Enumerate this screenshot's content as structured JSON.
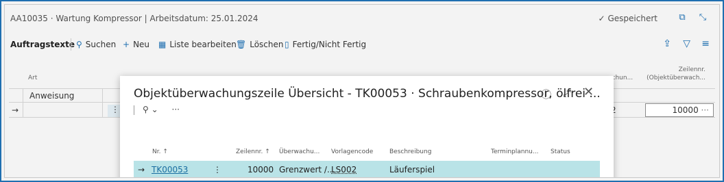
{
  "window": {
    "title": "AA10035 · Wartung Kompressor | Arbeitsdatum: 25.01.2024",
    "saved_label": "Gespeichert"
  },
  "toolbar": {
    "section_label": "Auftragstexte",
    "search_label": "Suchen",
    "new_label": "Neu",
    "edit_list_label": "Liste bearbeiten",
    "delete_label": "Löschen",
    "done_label": "Fertig/Nicht Fertig"
  },
  "grid": {
    "col_art": "Art",
    "col_right1": "achun...",
    "col_right2_line1": "Zeilennr.",
    "col_right2_line2": "(Objektüberwach...",
    "row1_art": "Anweisung",
    "row2_arrow": "→",
    "row2_menu": "⋮",
    "row2_right1": "2",
    "row2_value": "10000"
  },
  "dialog": {
    "title": "Objektüberwachungszeile Übersicht - TK00053 · Schraubenkompressor, ölfrei ...",
    "more": "···",
    "columns": [
      "Nr. ↑",
      "Zeilennr. ↑",
      "Überwachu...",
      "Vorlagencode",
      "Beschreibung",
      "Terminplannu...",
      "Status"
    ],
    "row": {
      "arrow": "→",
      "nr": "TK00053",
      "menu": "⋮",
      "zeilennr": "10000",
      "ueberwachung": "Grenzwert /...",
      "vorlagencode": "LS002",
      "beschreibung": "Läuferspiel",
      "terminplanung": "",
      "status": ""
    }
  },
  "colors": {
    "accent": "#1f6fb0",
    "selected_row": "#b9e3e7",
    "link": "#1a6ea1"
  }
}
